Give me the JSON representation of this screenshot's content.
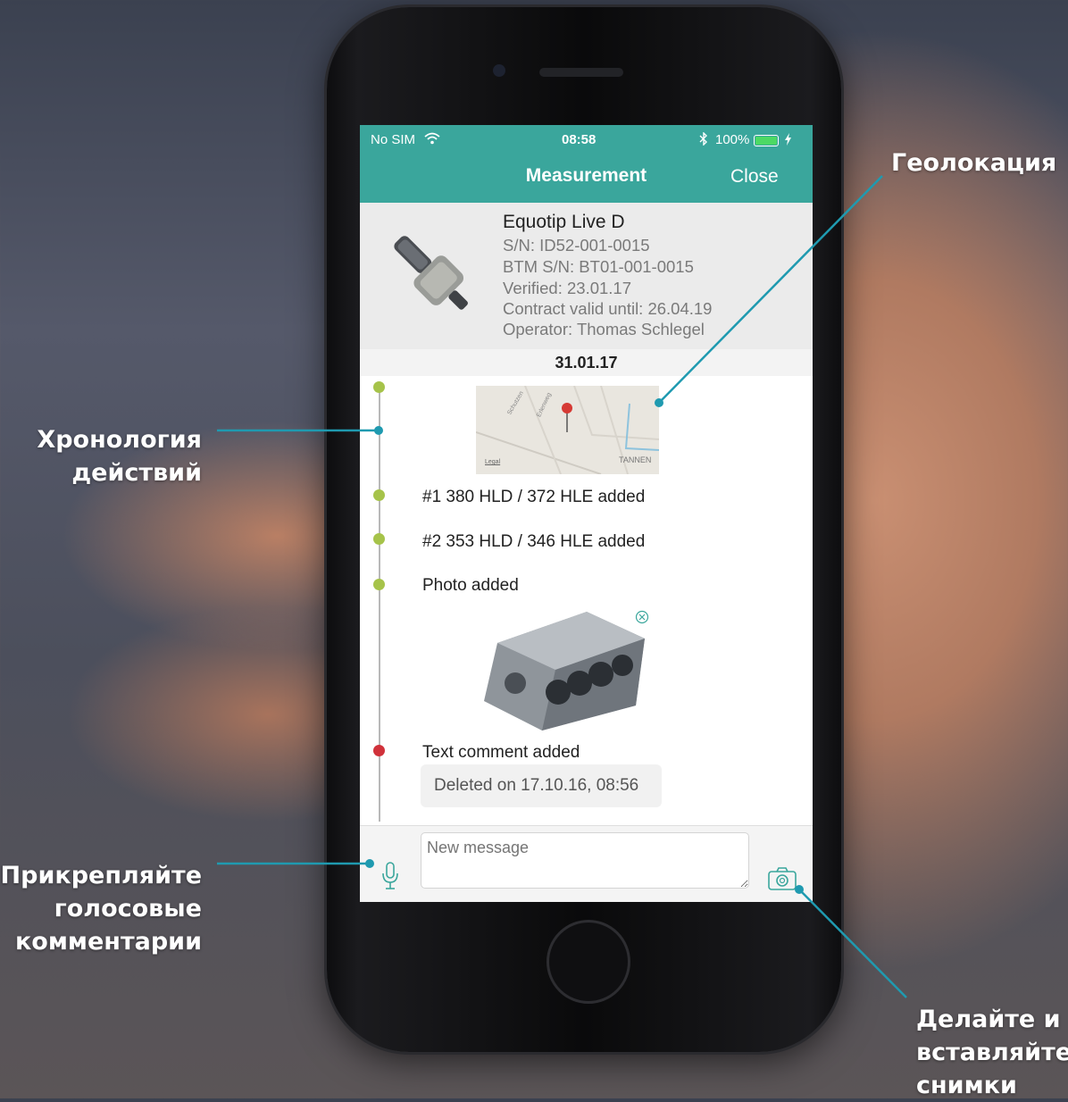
{
  "colors": {
    "accent": "#3aa69c",
    "dot_green": "#a6c34a",
    "dot_red": "#d0313a",
    "battery": "#4cd964",
    "pin": "#d63a34"
  },
  "status_bar": {
    "carrier": "No SIM",
    "time": "08:58",
    "battery": "100%"
  },
  "nav": {
    "title": "Measurement",
    "close_label": "Close"
  },
  "device": {
    "name": "Equotip Live D",
    "serial": "S/N: ID52-001-0015",
    "btm_serial": "BTM S/N: BT01-001-0015",
    "verified": "Verified: 23.01.17",
    "contract": "Contract valid until: 26.04.19",
    "operator": "Operator: Thomas Schlegel"
  },
  "timeline": {
    "date": "31.01.17",
    "map": {
      "street1": "Schutzen",
      "street2": "Erlenweg",
      "area": "TANNEN",
      "legal": "Legal"
    },
    "entries": [
      {
        "text": "#1 380 HLD / 372 HLE added"
      },
      {
        "text": "#2 353 HLD / 346 HLE added"
      },
      {
        "text": "Photo added"
      },
      {
        "text": "Text comment added"
      }
    ],
    "deleted_note": "Deleted on 17.10.16, 08:56"
  },
  "composer": {
    "placeholder": "New message"
  },
  "icons": [
    "wifi-icon",
    "bluetooth-icon",
    "battery-icon",
    "charging-icon",
    "map-pin-icon",
    "close-circle-icon",
    "microphone-icon",
    "camera-icon"
  ],
  "annotations": {
    "geolocation": "Геолокация",
    "timeline_line1": "Хронология",
    "timeline_line2": "действий",
    "voice_line1": "Прикрепляйте",
    "voice_line2": "голосовые",
    "voice_line3": "комментарии",
    "photo_line1": "Делайте и",
    "photo_line2": "вставляйте",
    "photo_line3": "снимки"
  }
}
